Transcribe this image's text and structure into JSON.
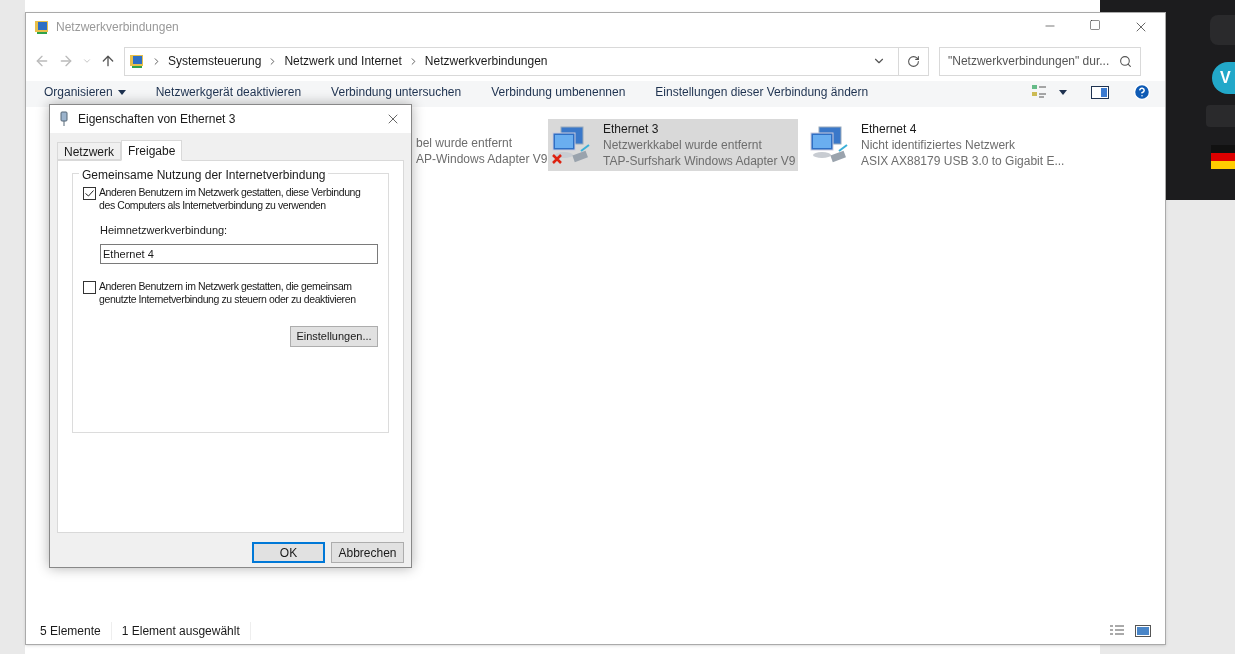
{
  "side_panel": {
    "button": "V"
  },
  "window": {
    "title": "Netzwerkverbindungen"
  },
  "breadcrumb": [
    "Systemsteuerung",
    "Netzwerk und Internet",
    "Netzwerkverbindungen"
  ],
  "search": {
    "placeholder": "\"Netzwerkverbindungen\" dur..."
  },
  "commands": [
    {
      "label": "Organisieren",
      "kind": "menu"
    },
    {
      "label": "Netzwerkgerät deaktivieren",
      "kind": "action"
    },
    {
      "label": "Verbindung untersuchen",
      "kind": "action"
    },
    {
      "label": "Verbindung umbenennen",
      "kind": "action"
    },
    {
      "label": "Einstellungen dieser Verbindung ändern",
      "kind": "action"
    }
  ],
  "partial_connection": {
    "status": "bel wurde entfernt",
    "adapter": "AP-Windows Adapter V9"
  },
  "connections": [
    {
      "name": "Ethernet 3",
      "status": "Netzwerkkabel wurde entfernt",
      "adapter": "TAP-Surfshark Windows Adapter V9",
      "selected": true,
      "disconnected": true
    },
    {
      "name": "Ethernet 4",
      "status": "Nicht identifiziertes Netzwerk",
      "adapter": "ASIX AX88179 USB 3.0 to Gigabit E...",
      "selected": false,
      "disconnected": false
    }
  ],
  "status_bar": [
    "5 Elemente",
    "1 Element ausgewählt"
  ],
  "dialog": {
    "title": "Eigenschaften von Ethernet 3",
    "tabs": [
      {
        "label": "Netzwerk",
        "selected": false
      },
      {
        "label": "Freigabe",
        "selected": true
      }
    ],
    "group_title": "Gemeinsame Nutzung der Internetverbindung",
    "options": [
      {
        "label": "Anderen Benutzern im Netzwerk gestatten, diese Verbindung des Computers als Internetverbindung zu verwenden",
        "checked": true
      },
      {
        "label": "Anderen Benutzern im Netzwerk gestatten, die gemeinsam genutzte Internetverbindung zu steuern oder zu deaktivieren",
        "checked": false
      }
    ],
    "home_network": {
      "label": "Heimnetzwerkverbindung:",
      "value": "Ethernet 4"
    },
    "settings_button": "Einstellungen...",
    "buttons": [
      {
        "label": "OK",
        "default": true
      },
      {
        "label": "Abbrechen",
        "default": false
      }
    ]
  }
}
